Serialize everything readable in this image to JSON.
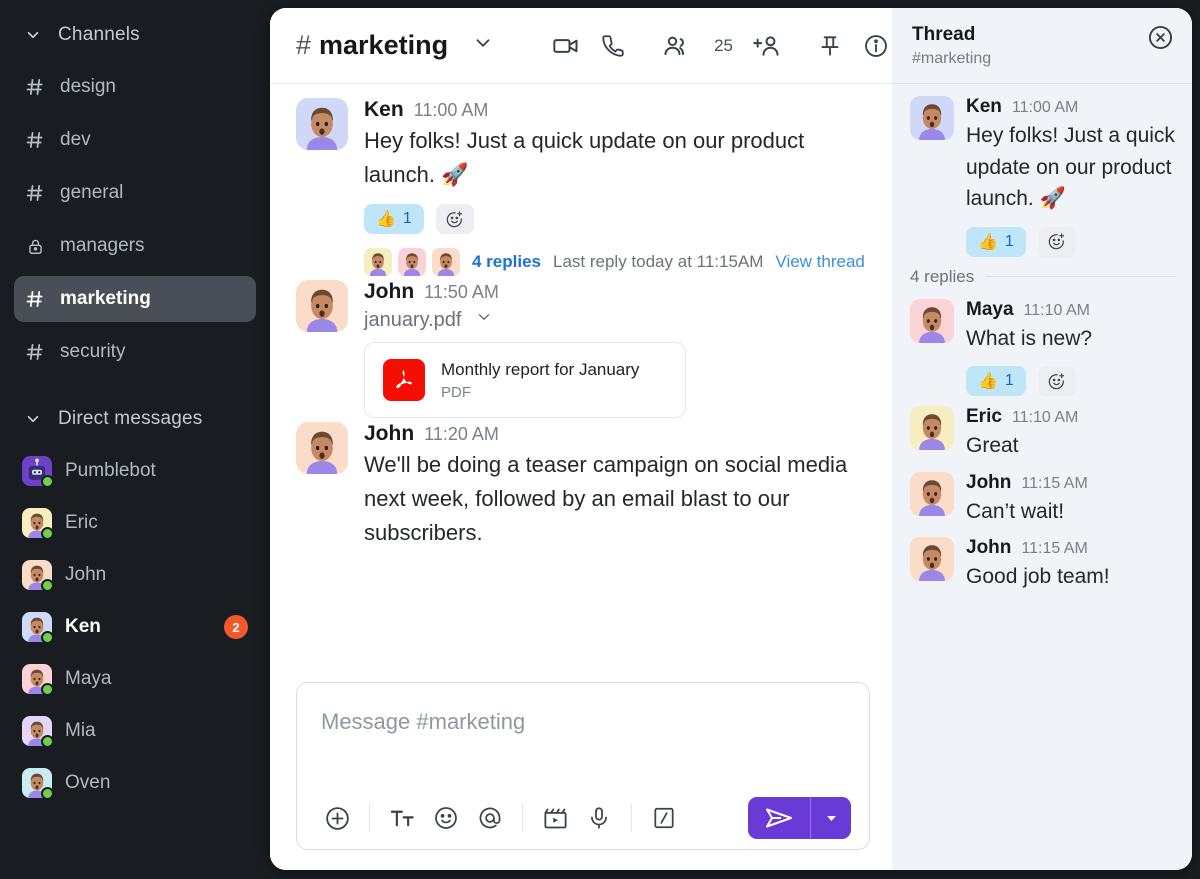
{
  "sidebar": {
    "channels_section": {
      "label": "Channels",
      "icon": "chevron-down-icon"
    },
    "channels": [
      {
        "name": "design",
        "icon": "hash-icon",
        "active": false
      },
      {
        "name": "dev",
        "icon": "hash-icon",
        "active": false
      },
      {
        "name": "general",
        "icon": "hash-icon",
        "active": false
      },
      {
        "name": "managers",
        "icon": "lock-icon",
        "active": false
      },
      {
        "name": "marketing",
        "icon": "hash-icon",
        "active": true
      },
      {
        "name": "security",
        "icon": "hash-icon",
        "active": false
      }
    ],
    "dm_section": {
      "label": "Direct messages",
      "icon": "chevron-down-icon"
    },
    "dms": [
      {
        "name": "Pumblebot",
        "badge": "",
        "online": true,
        "avatar_bg": "#6b42c8"
      },
      {
        "name": "Eric",
        "badge": "",
        "online": true,
        "avatar_bg": "#f6eec0"
      },
      {
        "name": "John",
        "badge": "",
        "online": true,
        "avatar_bg": "#fadcc8"
      },
      {
        "name": "Ken",
        "badge": "2",
        "online": true,
        "avatar_bg": "#cfd9f7"
      },
      {
        "name": "Maya",
        "badge": "",
        "online": true,
        "avatar_bg": "#fbd3d7"
      },
      {
        "name": "Mia",
        "badge": "",
        "online": true,
        "avatar_bg": "#e4d7f6"
      },
      {
        "name": "Oven",
        "badge": "",
        "online": true,
        "avatar_bg": "#c9ecf3"
      }
    ],
    "badge_color": "#f4592c",
    "active_bg": "#4a4f57"
  },
  "header": {
    "hash": "#",
    "channel": "marketing",
    "chevron_icon": "chevron-down-icon",
    "video_icon": "video-camera-icon",
    "call_icon": "phone-icon",
    "members_icon": "members-icon",
    "member_count": "25",
    "add_member_icon": "add-person-icon",
    "pin_icon": "pin-icon",
    "info_icon": "info-icon"
  },
  "messages": [
    {
      "author": "Ken",
      "time": "11:00 AM",
      "text": "Hey folks! Just a quick update on our product launch. 🚀",
      "avatar_bg": "#cfd9f7",
      "reaction": {
        "emoji": "👍",
        "count": "1"
      },
      "add_reaction_icon": "add-reaction-icon",
      "thread": {
        "count_label": "4 replies",
        "meta": "Last reply today at 11:15AM",
        "link": "View thread",
        "avatars": [
          "#f6eec0",
          "#fbd3d7",
          "#fadcc8"
        ]
      }
    },
    {
      "author": "John",
      "time": "11:50 AM",
      "avatar_bg": "#fadcc8",
      "file_name": "january.pdf",
      "file_chevron_icon": "chevron-down-icon",
      "file_card": {
        "title": "Monthly report for January",
        "type": "PDF",
        "icon": "pdf-icon",
        "color": "#f40f02"
      }
    },
    {
      "author": "John",
      "time": "11:20 AM",
      "avatar_bg": "#fadcc8",
      "text": "We'll be doing a teaser campaign on social media next week, followed by an email blast to our subscribers."
    }
  ],
  "composer": {
    "placeholder": "Message #marketing",
    "tools": [
      {
        "icon": "plus-circle-icon",
        "name": "attach-button"
      },
      {
        "icon": "format-text-icon",
        "name": "format-button"
      },
      {
        "icon": "emoji-icon",
        "name": "emoji-button"
      },
      {
        "icon": "mention-icon",
        "name": "mention-button"
      },
      {
        "icon": "video-clip-icon",
        "name": "video-clip-button"
      },
      {
        "icon": "microphone-icon",
        "name": "voice-button"
      },
      {
        "icon": "slash-command-icon",
        "name": "slash-command-button"
      }
    ],
    "send_icon": "send-icon",
    "send_dropdown_icon": "chevron-down-icon",
    "send_color": "#6a3ad6"
  },
  "thread_panel": {
    "title": "Thread",
    "subtitle": "#marketing",
    "close_icon": "close-circle-icon",
    "root": {
      "author": "Ken",
      "time": "11:00 AM",
      "text": "Hey folks! Just a quick update on our product launch. 🚀",
      "avatar_bg": "#cfd9f7",
      "reaction": {
        "emoji": "👍",
        "count": "1"
      },
      "add_reaction_icon": "add-reaction-icon"
    },
    "replies_divider": "4 replies",
    "replies": [
      {
        "author": "Maya",
        "time": "11:10 AM",
        "text": "What is new?",
        "avatar_bg": "#fbd3d7",
        "reaction": {
          "emoji": "👍",
          "count": "1"
        },
        "add_reaction_icon": "add-reaction-icon"
      },
      {
        "author": "Eric",
        "time": "11:10 AM",
        "text": "Great",
        "avatar_bg": "#f6eec0"
      },
      {
        "author": "John",
        "time": "11:15 AM",
        "text": "Can’t wait!",
        "avatar_bg": "#fadcc8"
      },
      {
        "author": "John",
        "time": "11:15 AM",
        "text": "Good job team!",
        "avatar_bg": "#fadcc8"
      }
    ]
  }
}
